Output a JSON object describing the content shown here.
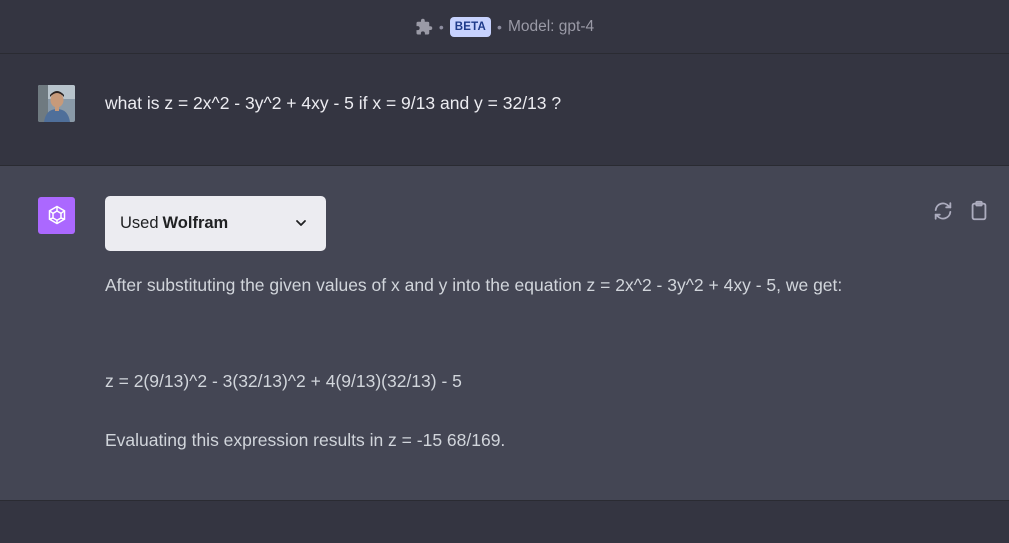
{
  "header": {
    "beta_label": "BETA",
    "model_text": "Model: gpt-4",
    "separator": "•"
  },
  "user_message": {
    "text": "what is z = 2x^2 - 3y^2 + 4xy - 5 if x = 9/13 and y = 32/13 ?"
  },
  "assistant_message": {
    "plugin_prefix": "Used",
    "plugin_name": "Wolfram",
    "paragraphs": [
      "After substituting the given values of x and y into the equation z = 2x^2 - 3y^2 + 4xy - 5, we get:",
      "z = 2(9/13)^2 - 3(32/13)^2 + 4(9/13)(32/13) - 5",
      "Evaluating this expression results in z = -15 68/169."
    ]
  },
  "icons": {
    "plugin": "puzzle-icon",
    "regenerate": "refresh-icon",
    "copy": "clipboard-icon",
    "expand": "chevron-down-icon"
  }
}
